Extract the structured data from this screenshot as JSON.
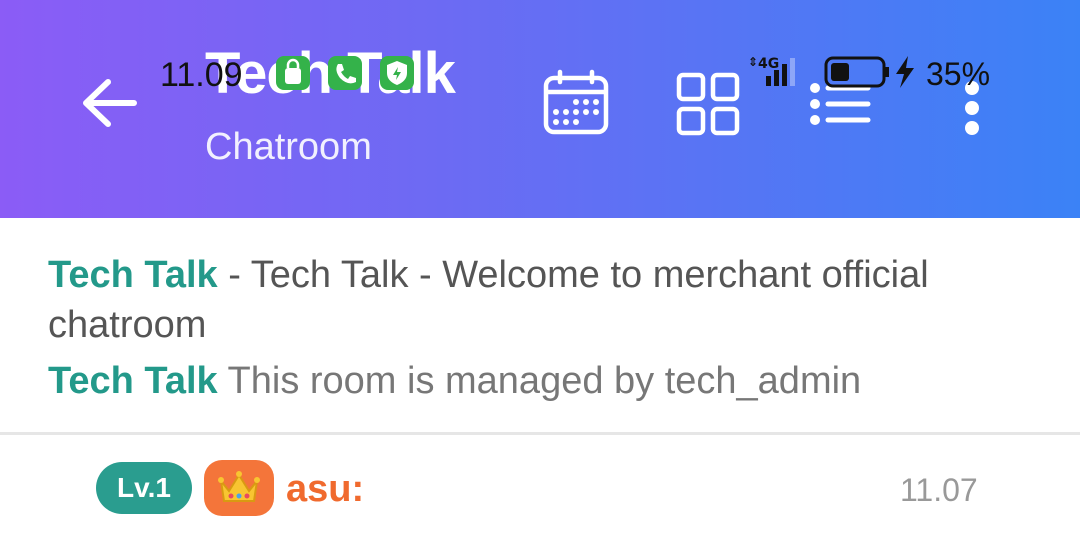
{
  "status_bar": {
    "time": "11.09",
    "battery_percent": "35%",
    "network": "4G",
    "apps": [
      "shopping-bag-icon",
      "phone-icon",
      "shield-icon"
    ]
  },
  "header": {
    "title": "Tech Talk",
    "subtitle": "Chatroom",
    "icons": [
      "back-arrow-icon",
      "calendar-icon",
      "grid-icon",
      "list-icon",
      "more-vertical-icon"
    ],
    "gradient_start": "#8b5cf6",
    "gradient_end": "#3b82f6"
  },
  "announcement": {
    "brand": "Tech Talk",
    "text": " - Tech Talk - Welcome to merchant official chatroom"
  },
  "managed": {
    "brand": "Tech Talk",
    "text": " This room is managed by tech_admin"
  },
  "messages": [
    {
      "level": "Lv.1",
      "badge_icon": "crown-icon",
      "username": "asu:",
      "time": "11.07"
    }
  ],
  "colors": {
    "brand_teal": "#23998a",
    "username_orange": "#f06a2e",
    "crown_badge": "#f4753a"
  }
}
